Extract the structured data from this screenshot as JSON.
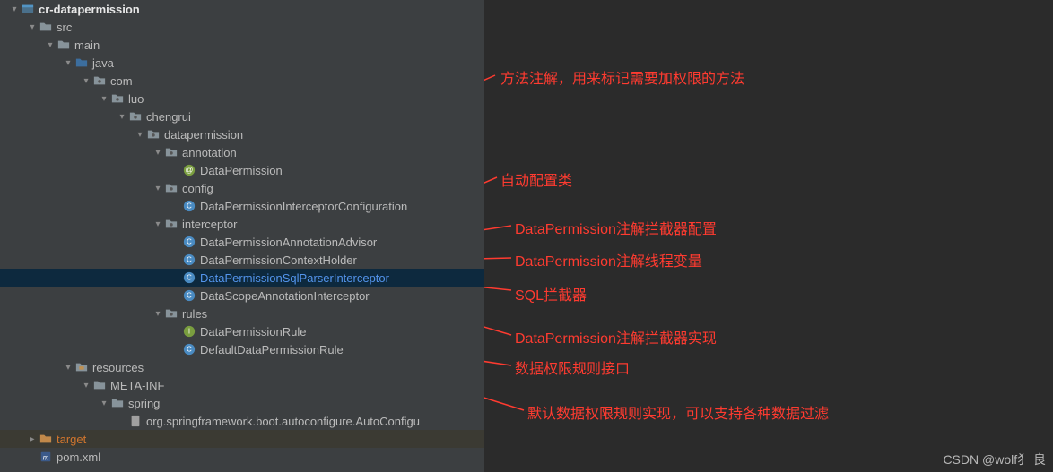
{
  "tree": {
    "root": "cr-datapermission",
    "src": "src",
    "main": "main",
    "java": "java",
    "com": "com",
    "luo": "luo",
    "chengrui": "chengrui",
    "datapermission": "datapermission",
    "annotation": "annotation",
    "dataPermission": "DataPermission",
    "config": "config",
    "dpic": "DataPermissionInterceptorConfiguration",
    "interceptor": "interceptor",
    "adv": "DataPermissionAnnotationAdvisor",
    "ctx": "DataPermissionContextHolder",
    "sql": "DataPermissionSqlParserInterceptor",
    "scope": "DataScopeAnnotationInterceptor",
    "rules": "rules",
    "rule": "DataPermissionRule",
    "defRule": "DefaultDataPermissionRule",
    "resources": "resources",
    "meta": "META-INF",
    "spring": "spring",
    "autoConfig": "org.springframework.boot.autoconfigure.AutoConfigu",
    "target": "target",
    "pom": "pom.xml"
  },
  "annotations": {
    "a1": "方法注解，用来标记需要加权限的方法",
    "a2": "自动配置类",
    "a3": "DataPermission注解拦截器配置",
    "a4": "DataPermission注解线程变量",
    "a5": "SQL拦截器",
    "a6": "DataPermission注解拦截器实现",
    "a7": "数据权限规则接口",
    "a8": "默认数据权限规则实现，可以支持各种数据过滤"
  },
  "watermark": "CSDN @wolf犭 良"
}
